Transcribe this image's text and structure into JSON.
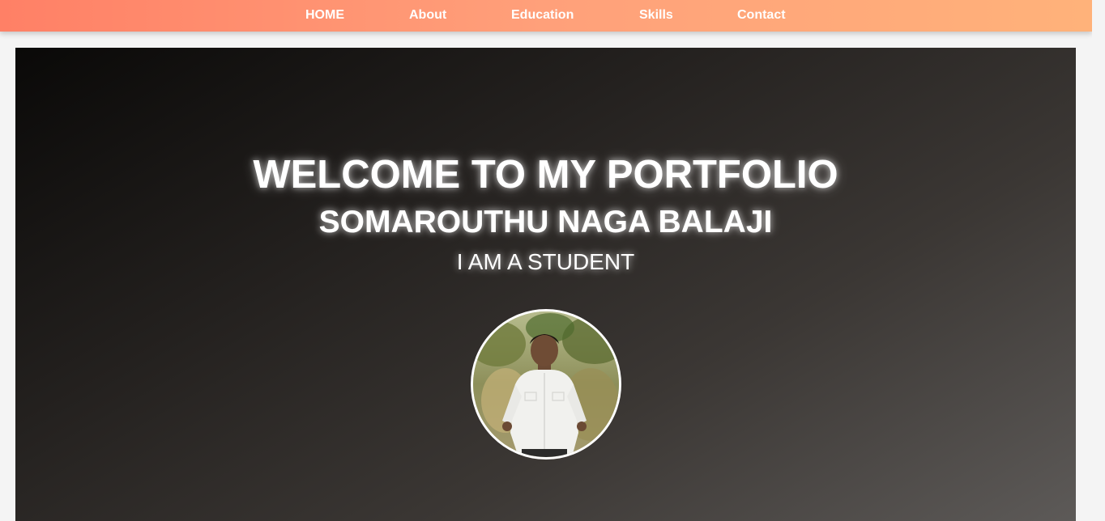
{
  "nav": {
    "items": [
      {
        "label": "HOME"
      },
      {
        "label": "About"
      },
      {
        "label": "Education"
      },
      {
        "label": "Skills"
      },
      {
        "label": "Contact"
      }
    ]
  },
  "hero": {
    "title": "WELCOME TO MY PORTFOLIO",
    "name": "SOMAROUTHU NAGA BALAJI",
    "role": "I AM A STUDENT"
  },
  "colors": {
    "nav_gradient_start": "#ff8066",
    "nav_gradient_end": "#ffb27a",
    "hero_dark": "#0a0908",
    "hero_light": "#5e5b59",
    "text": "#ffffff"
  },
  "icons": {
    "avatar": "profile-photo"
  }
}
